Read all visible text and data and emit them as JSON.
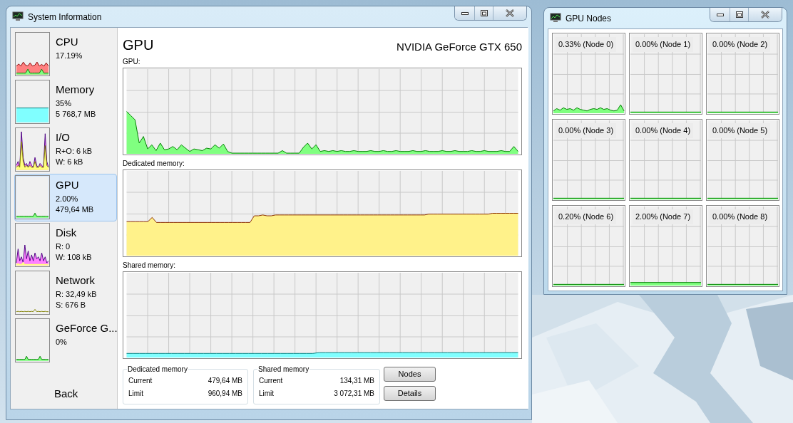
{
  "main_window": {
    "title": "System Information",
    "sidebar": {
      "items": [
        {
          "kind": "cpu",
          "name": "CPU",
          "lines": [
            "17.19%"
          ],
          "selected": false
        },
        {
          "kind": "memory",
          "name": "Memory",
          "lines": [
            "35%",
            "5 768,7 MB"
          ],
          "selected": false
        },
        {
          "kind": "io",
          "name": "I/O",
          "lines": [
            "R+O: 6 kB",
            "W: 6 kB"
          ],
          "selected": false
        },
        {
          "kind": "gpu",
          "name": "GPU",
          "lines": [
            "2.00%",
            "479,64 MB"
          ],
          "selected": true
        },
        {
          "kind": "disk",
          "name": "Disk",
          "lines": [
            "R: 0",
            "W: 108 kB"
          ],
          "selected": false
        },
        {
          "kind": "network",
          "name": "Network",
          "lines": [
            "R: 32,49 kB",
            "S: 676 B"
          ],
          "selected": false
        },
        {
          "kind": "engine",
          "name": "GeForce G...",
          "lines": [
            "0%"
          ],
          "selected": false
        }
      ],
      "back": "Back"
    },
    "panel": {
      "title": "GPU",
      "device": "NVIDIA GeForce GTX 650",
      "graphs": [
        {
          "kind": "usage",
          "label": "GPU:"
        },
        {
          "kind": "dedicated",
          "label": "Dedicated memory:"
        },
        {
          "kind": "shared",
          "label": "Shared memory:"
        }
      ],
      "groups": [
        {
          "title": "Dedicated memory",
          "rows": [
            {
              "label": "Current",
              "value": "479,64 MB"
            },
            {
              "label": "Limit",
              "value": "960,94 MB"
            }
          ]
        },
        {
          "title": "Shared memory",
          "rows": [
            {
              "label": "Current",
              "value": "134,31 MB"
            },
            {
              "label": "Limit",
              "value": "3 072,31 MB"
            }
          ]
        }
      ],
      "buttons": [
        "Nodes",
        "Details"
      ]
    }
  },
  "nodes_window": {
    "title": "GPU Nodes",
    "nodes": [
      {
        "label": "0.33% (Node 0)",
        "kind": "activity"
      },
      {
        "label": "0.00% (Node 1)",
        "kind": "flat"
      },
      {
        "label": "0.00% (Node 2)",
        "kind": "flat"
      },
      {
        "label": "0.00% (Node 3)",
        "kind": "flat"
      },
      {
        "label": "0.00% (Node 4)",
        "kind": "flat"
      },
      {
        "label": "0.00% (Node 5)",
        "kind": "flat"
      },
      {
        "label": "0.20% (Node 6)",
        "kind": "flat"
      },
      {
        "label": "2.00% (Node 7)",
        "kind": "bar"
      },
      {
        "label": "0.00% (Node 8)",
        "kind": "flat"
      }
    ]
  }
}
